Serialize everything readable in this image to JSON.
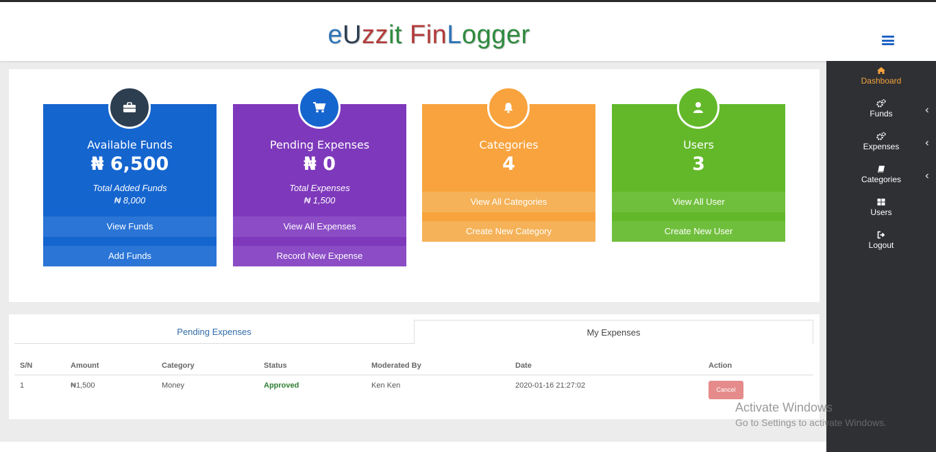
{
  "brand": {
    "parts": [
      {
        "text": "e",
        "color": "#2e75b8"
      },
      {
        "text": "U",
        "color": "#2c3e50"
      },
      {
        "text": "zz",
        "color": "#b23a3a"
      },
      {
        "text": "it ",
        "color": "#2e8b3e"
      },
      {
        "text": "Fin",
        "color": "#b23a3a"
      },
      {
        "text": "L",
        "color": "#2e75b8"
      },
      {
        "text": "ogger",
        "color": "#2e8b3e"
      }
    ]
  },
  "sidebar": {
    "items": [
      {
        "label": "Dashboard",
        "icon": "home-icon",
        "active": true
      },
      {
        "label": "Funds",
        "icon": "cogs-icon",
        "expandable": true
      },
      {
        "label": "Expenses",
        "icon": "cogs-icon",
        "expandable": true
      },
      {
        "label": "Categories",
        "icon": "book-icon",
        "expandable": true
      },
      {
        "label": "Users",
        "icon": "grid-icon"
      },
      {
        "label": "Logout",
        "icon": "logout-icon"
      }
    ]
  },
  "cards": {
    "funds": {
      "title": "Available Funds",
      "value": "₦ 6,500",
      "sub_label": "Total Added Funds",
      "sub_value": "₦ 8,000",
      "btn1": "View Funds",
      "btn2": "Add Funds",
      "icon": "briefcase-icon"
    },
    "expenses": {
      "title": "Pending Expenses",
      "value": "₦ 0",
      "sub_label": "Total Expenses",
      "sub_value": "₦ 1,500",
      "btn1": "View All Expenses",
      "btn2": "Record New Expense",
      "icon": "cart-icon"
    },
    "categories": {
      "title": "Categories",
      "value": "4",
      "btn1": "View All Categories",
      "btn2": "Create New Category",
      "icon": "bell-icon"
    },
    "users": {
      "title": "Users",
      "value": "3",
      "btn1": "View All User",
      "btn2": "Create New User",
      "icon": "user-icon"
    }
  },
  "tabs": {
    "pending": "Pending Expenses",
    "mine": "My Expenses"
  },
  "table": {
    "headers": {
      "sn": "S/N",
      "amount": "Amount",
      "category": "Category",
      "status": "Status",
      "moderated": "Moderated By",
      "date": "Date",
      "action": "Action"
    },
    "rows": [
      {
        "sn": "1",
        "amount": "₦1,500",
        "category": "Money",
        "status": "Approved",
        "moderated": "Ken Ken",
        "date": "2020-01-16 21:27:02",
        "action": "Cancel"
      }
    ]
  },
  "watermark": {
    "line1": "Activate Windows",
    "line2": "Go to Settings to activate Windows."
  }
}
